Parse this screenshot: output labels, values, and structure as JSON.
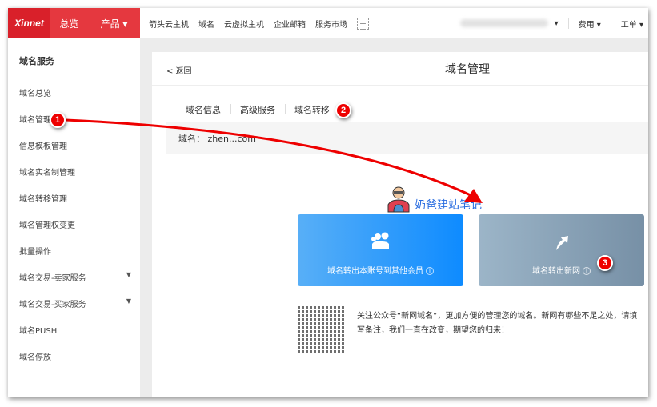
{
  "topbar": {
    "logo": "Xinnet",
    "overview": "总览",
    "products": "产品 ▾",
    "nav": [
      "箭头云主机",
      "域名",
      "云虚拟主机",
      "企业邮箱",
      "服务市场"
    ],
    "plus": "+",
    "user_caret": "▾",
    "fees": "费用 ▾",
    "tickets": "工单 ▾"
  },
  "sidebar": {
    "title": "域名服务",
    "items": [
      {
        "label": "域名总览"
      },
      {
        "label": "域名管理"
      },
      {
        "label": "信息模板管理"
      },
      {
        "label": "域名实名制管理"
      },
      {
        "label": "域名转移管理"
      },
      {
        "label": "域名管理权变更"
      },
      {
        "label": "批量操作"
      },
      {
        "label": "域名交易-卖家服务",
        "caret": "▼"
      },
      {
        "label": "域名交易-买家服务",
        "caret": "▼"
      },
      {
        "label": "域名PUSH"
      },
      {
        "label": "域名停放"
      }
    ]
  },
  "panel": {
    "back": "< 返回",
    "title": "域名管理",
    "tabs": [
      "域名信息",
      "高级服务",
      "域名转移"
    ],
    "active_tab": "域名转移",
    "domain_label": "域名：",
    "domain_value": "zhen...com"
  },
  "cards": [
    {
      "label": "域名转出本账号到其他会员",
      "info": "i",
      "icon": "users-icon",
      "color": "#1a90fe"
    },
    {
      "label": "域名转出新网",
      "info": "i",
      "icon": "arrow-up-icon",
      "color": "#8aa3b8"
    }
  ],
  "note": "关注公众号“新网域名”，更加方便的管理您的域名。新网有哪些不足之处，请填写备注，我们一直在改变，期望您的归来！",
  "watermark": "奶爸建站笔记",
  "annotations": [
    "1",
    "2",
    "3"
  ],
  "colors": {
    "brand_red": "#d9202a",
    "active_tab": "#e5383f",
    "arrow": "#ee0000"
  }
}
